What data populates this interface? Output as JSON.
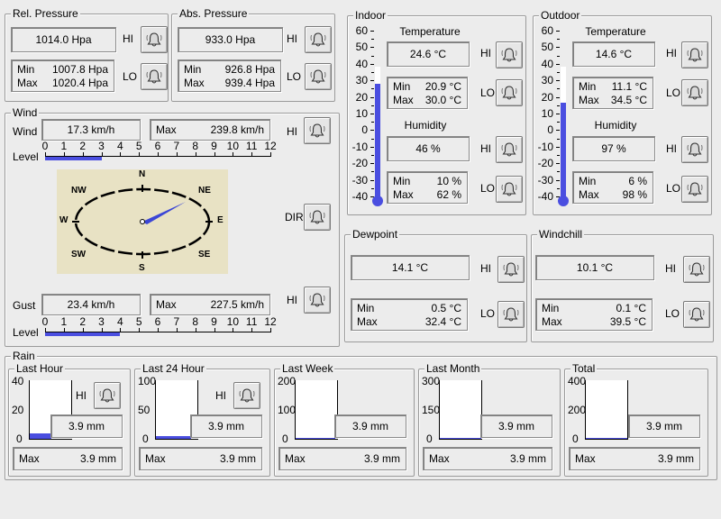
{
  "rel_pressure": {
    "title": "Rel. Pressure",
    "value": "1014.0 Hpa",
    "min_label": "Min",
    "min_value": "1007.8 Hpa",
    "max_label": "Max",
    "max_value": "1020.4 Hpa",
    "hi": "HI",
    "lo": "LO"
  },
  "abs_pressure": {
    "title": "Abs. Pressure",
    "value": "933.0 Hpa",
    "min_label": "Min",
    "min_value": "926.8 Hpa",
    "max_label": "Max",
    "max_value": "939.4 Hpa",
    "hi": "HI",
    "lo": "LO"
  },
  "wind": {
    "title": "Wind",
    "wind_label": "Wind",
    "wind_value": "17.3 km/h",
    "max_label": "Max",
    "max_value": "239.8 km/h",
    "hi": "HI",
    "level_label": "Level",
    "level_ticks": [
      "0",
      "1",
      "2",
      "3",
      "4",
      "5",
      "6",
      "7",
      "8",
      "9",
      "10",
      "11",
      "12"
    ],
    "wind_level": 3,
    "dir_label": "DIR",
    "compass": [
      "N",
      "NE",
      "E",
      "SE",
      "S",
      "SW",
      "W",
      "NW"
    ],
    "gust_label": "Gust",
    "gust_value": "23.4 km/h",
    "gust_max_label": "Max",
    "gust_max_value": "227.5 km/h",
    "gust_hi": "HI",
    "gust_level": 4
  },
  "indoor": {
    "title": "Indoor",
    "temp_title": "Temperature",
    "temp_value": "24.6 °C",
    "temp_min": "20.9 °C",
    "temp_max": "30.0 °C",
    "hum_title": "Humidity",
    "hum_value": "46 %",
    "hum_min": "10 %",
    "hum_max": "62 %",
    "min_label": "Min",
    "max_label": "Max",
    "hi": "HI",
    "lo": "LO",
    "thermo_fill": 0.74
  },
  "outdoor": {
    "title": "Outdoor",
    "temp_title": "Temperature",
    "temp_value": "14.6 °C",
    "temp_min": "11.1 °C",
    "temp_max": "34.5 °C",
    "hum_title": "Humidity",
    "hum_value": "97 %",
    "hum_min": "6 %",
    "hum_max": "98 %",
    "min_label": "Min",
    "max_label": "Max",
    "hi": "HI",
    "lo": "LO",
    "thermo_fill": 0.6
  },
  "thermo_scale": [
    "60",
    "50",
    "40",
    "30",
    "20",
    "10",
    "0",
    "-10",
    "-20",
    "-30",
    "-40"
  ],
  "dewpoint": {
    "title": "Dewpoint",
    "value": "14.1 °C",
    "min_label": "Min",
    "min_value": "0.5 °C",
    "max_label": "Max",
    "max_value": "32.4 °C",
    "hi": "HI",
    "lo": "LO"
  },
  "windchill": {
    "title": "Windchill",
    "value": "10.1 °C",
    "min_label": "Min",
    "min_value": "0.1 °C",
    "max_label": "Max",
    "max_value": "39.5 °C",
    "hi": "HI",
    "lo": "LO"
  },
  "rain": {
    "title": "Rain",
    "panels": [
      {
        "title": "Last Hour",
        "scale": [
          "40",
          "20",
          "0"
        ],
        "value": "3.9 mm",
        "max_label": "Max",
        "max_value": "3.9 mm",
        "hi": "HI",
        "fill": 0.1
      },
      {
        "title": "Last 24 Hour",
        "scale": [
          "100",
          "50",
          "0"
        ],
        "value": "3.9 mm",
        "max_label": "Max",
        "max_value": "3.9 mm",
        "hi": "HI",
        "fill": 0.04
      },
      {
        "title": "Last Week",
        "scale": [
          "200",
          "100",
          "0"
        ],
        "value": "3.9 mm",
        "max_label": "Max",
        "max_value": "3.9 mm",
        "fill": 0.02
      },
      {
        "title": "Last Month",
        "scale": [
          "300",
          "150",
          "0"
        ],
        "value": "3.9 mm",
        "max_label": "Max",
        "max_value": "3.9 mm",
        "fill": 0.0
      },
      {
        "title": "Total",
        "scale": [
          "400",
          "200",
          "0"
        ],
        "value": "3.9 mm",
        "max_label": "Max",
        "max_value": "3.9 mm",
        "fill": 0.0
      }
    ]
  },
  "colors": {
    "bar": "#4a4ee0",
    "compass_bg": "#e8e2c4",
    "needle": "#3b46d6"
  },
  "icons": {
    "alarm": "bell-icon"
  }
}
